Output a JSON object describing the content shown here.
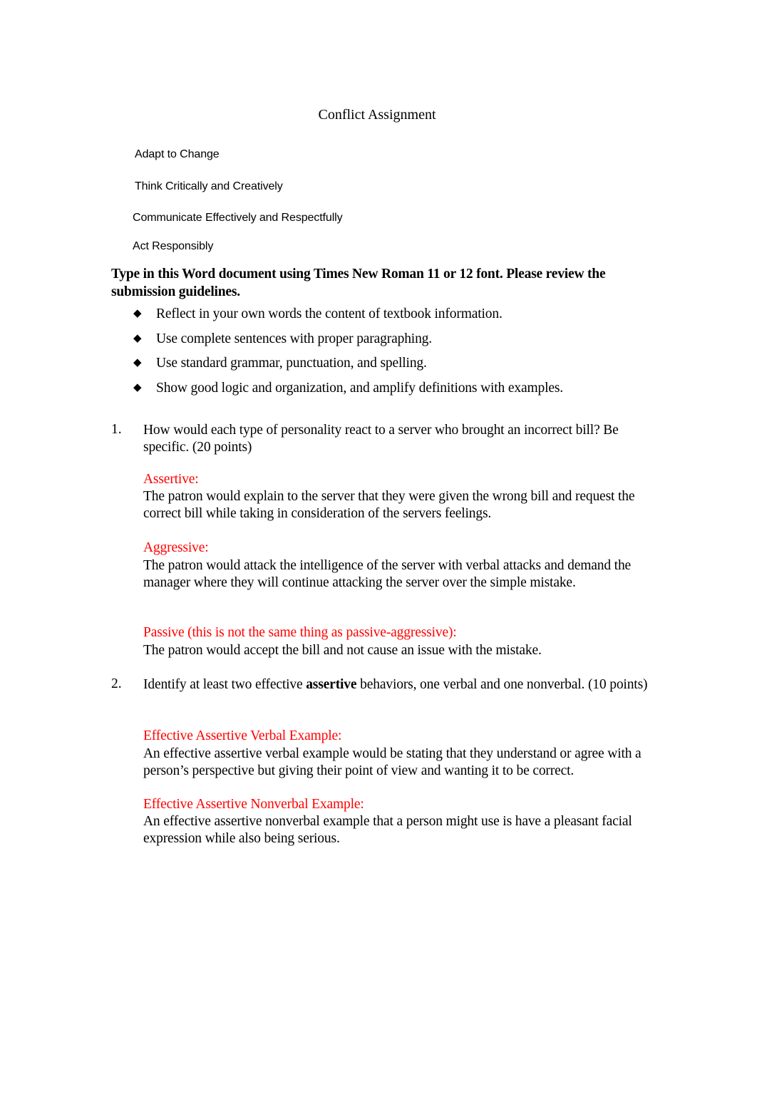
{
  "document": {
    "title": "Conflict Assignment",
    "skills": [
      "Adapt to Change",
      "Think Critically and Creatively",
      "Communicate Effectively and Respectfully",
      "Act Responsibly"
    ],
    "instructions": "Type in this Word document using Times New Roman 11 or 12 font. Please review the submission guidelines.",
    "bullets": [
      "Reflect in your own words the content of textbook information.",
      "Use complete sentences with proper paragraphing.",
      "Use standard grammar, punctuation, and spelling.",
      "Show good logic and organization, and amplify definitions with examples."
    ],
    "bullet_icon": "diamond-icon",
    "accent_color": "#ff0000",
    "questions": [
      {
        "number": "1.",
        "text": "How would each type of personality react to a server who brought an incorrect bill? Be specific. (20 points)",
        "answers": [
          {
            "label": "Assertive:",
            "text": "The patron would explain to the server that they were given the wrong bill and request the correct bill while taking in consideration of the servers feelings."
          },
          {
            "label": "Aggressive:",
            "text": "The patron would attack the intelligence of the server with verbal attacks and demand the manager where they will continue attacking the server over the simple mistake."
          },
          {
            "label": "Passive (this is not the same thing as passive-aggressive):",
            "text": "The patron would accept the bill and not cause an issue with the mistake."
          }
        ]
      },
      {
        "number": "2.",
        "text_before_bold": "Identify at least two effective ",
        "text_bold": "assertive",
        "text_after_bold": " behaviors, one verbal and one nonverbal. (10 points)",
        "answers": [
          {
            "label": "Effective Assertive Verbal Example:",
            "text": "An effective assertive verbal example would be stating that they understand or agree with a person’s perspective but giving their point of view and wanting it to be correct."
          },
          {
            "label": "Effective Assertive Nonverbal Example:",
            "text": "An effective assertive nonverbal example that a person might use is have a pleasant facial expression while also being serious."
          }
        ]
      }
    ]
  }
}
